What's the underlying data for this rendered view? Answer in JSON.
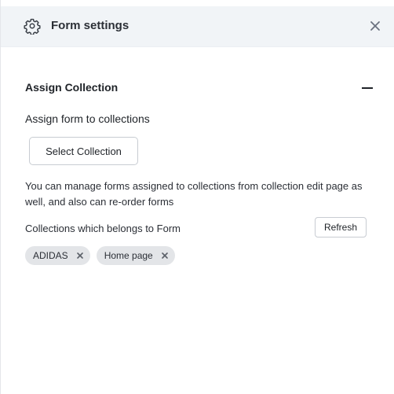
{
  "header": {
    "title": "Form settings",
    "icon": "gear-icon",
    "close_icon": "close-icon"
  },
  "section": {
    "title": "Assign Collection",
    "collapse_icon": "minus-icon",
    "assign_label": "Assign form to collections",
    "select_button": "Select Collection",
    "info_text": "You can manage forms assigned to collections from collection edit page as well, and also can re-order forms",
    "belongs_label": "Collections which belongs to Form",
    "refresh_button": "Refresh",
    "tags": [
      {
        "label": "ADIDAS"
      },
      {
        "label": "Home page"
      }
    ]
  },
  "colors": {
    "header_bg": "#f1f4f7",
    "tag_bg": "#e3e5e8",
    "text": "#1f2328",
    "border": "#c8ccd2"
  }
}
